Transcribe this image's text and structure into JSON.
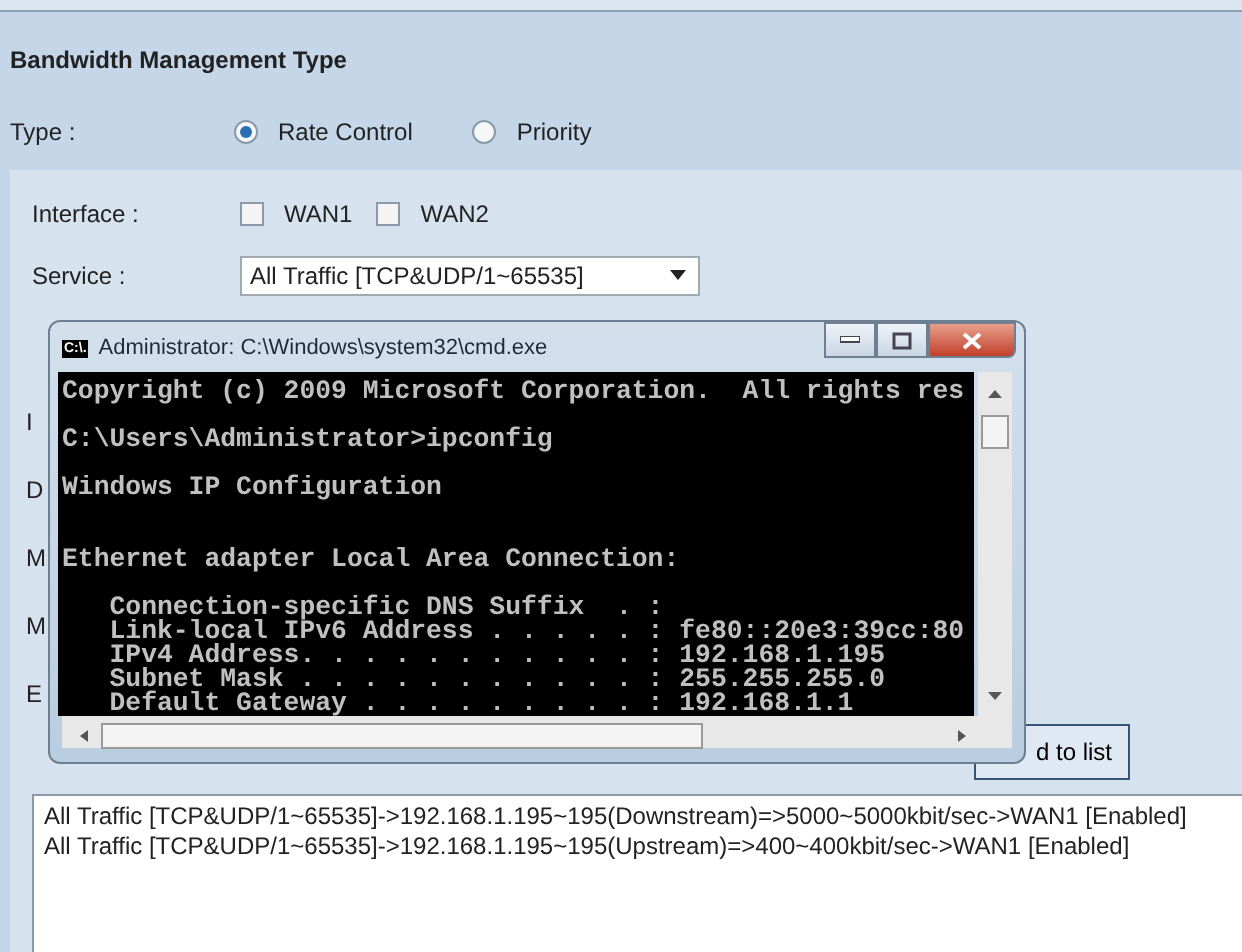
{
  "section_title": "Bandwidth Management Type",
  "type": {
    "label": "Type :",
    "options": [
      {
        "label": "Rate Control",
        "selected": true
      },
      {
        "label": "Priority",
        "selected": false
      }
    ]
  },
  "interface": {
    "label": "Interface :",
    "options": [
      {
        "label": "WAN1",
        "checked": false
      },
      {
        "label": "WAN2",
        "checked": false
      }
    ]
  },
  "service": {
    "label": "Service :",
    "value": "All Traffic [TCP&UDP/1~65535]"
  },
  "hidden_labels": [
    "I",
    "D",
    "M",
    "M",
    "E"
  ],
  "add_button": {
    "label": "d to list"
  },
  "rules": [
    "All Traffic [TCP&UDP/1~65535]->192.168.1.195~195(Downstream)=>5000~5000kbit/sec->WAN1 [Enabled]",
    "All Traffic [TCP&UDP/1~65535]->192.168.1.195~195(Upstream)=>400~400kbit/sec->WAN1 [Enabled]"
  ],
  "console_window": {
    "title": "Administrator: C:\\Windows\\system32\\cmd.exe",
    "icon": "C:\\.",
    "output": "Copyright (c) 2009 Microsoft Corporation.  All rights res\n\nC:\\Users\\Administrator>ipconfig\n\nWindows IP Configuration\n\n\nEthernet adapter Local Area Connection:\n\n   Connection-specific DNS Suffix  . :\n   Link-local IPv6 Address . . . . . : fe80::20e3:39cc:80\n   IPv4 Address. . . . . . . . . . . : 192.168.1.195\n   Subnet Mask . . . . . . . . . . . : 255.255.255.0\n   Default Gateway . . . . . . . . . : 192.168.1.1"
  }
}
